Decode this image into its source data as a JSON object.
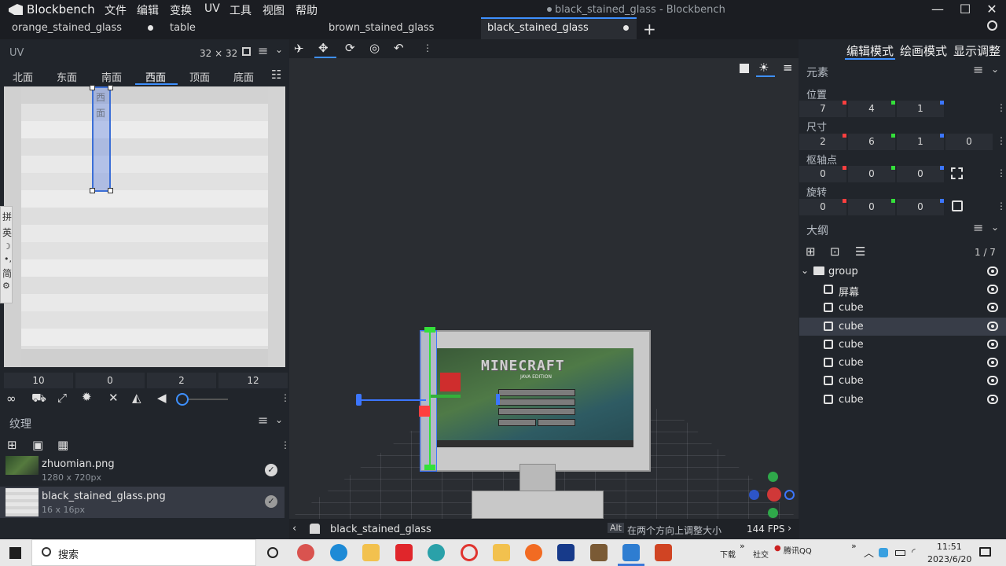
{
  "app": {
    "name": "Blockbench",
    "window_title": "black_stained_glass - Blockbench",
    "menu": [
      "文件",
      "编辑",
      "变换",
      "UV",
      "工具",
      "视图",
      "帮助"
    ]
  },
  "tabs": [
    {
      "label": "orange_stained_glass"
    },
    {
      "label": "table"
    },
    {
      "label": "brown_stained_glass"
    },
    {
      "label": "black_stained_glass",
      "active": true
    }
  ],
  "uv_panel": {
    "title": "UV",
    "size": "32 × 32",
    "faces": [
      "北面",
      "东面",
      "南面",
      "西面",
      "顶面",
      "底面"
    ],
    "selected_face": "西面",
    "face_overlay_label": "西面",
    "values": [
      "10",
      "0",
      "2",
      "12"
    ]
  },
  "texture_panel": {
    "title": "纹理",
    "items": [
      {
        "name": "zhuomian.png",
        "size": "1280 x 720px"
      },
      {
        "name": "black_stained_glass.png",
        "size": "16 x 16px",
        "selected": true
      }
    ]
  },
  "ime_bar": [
    "拼",
    "英",
    "简"
  ],
  "mode_tabs": [
    "编辑模式",
    "绘画模式",
    "显示调整"
  ],
  "element_panel": {
    "title": "元素",
    "position": {
      "label": "位置",
      "values": [
        "7",
        "4",
        "1"
      ]
    },
    "size": {
      "label": "尺寸",
      "values": [
        "2",
        "6",
        "1",
        "0"
      ]
    },
    "pivot": {
      "label": "枢轴点",
      "values": [
        "0",
        "0",
        "0"
      ]
    },
    "rotation": {
      "label": "旋转",
      "values": [
        "0",
        "0",
        "0"
      ]
    }
  },
  "outliner": {
    "title": "大纲",
    "count": "1 / 7",
    "group": "group",
    "items": [
      {
        "label": "屏幕"
      },
      {
        "label": "cube"
      },
      {
        "label": "cube",
        "selected": true
      },
      {
        "label": "cube"
      },
      {
        "label": "cube"
      },
      {
        "label": "cube"
      },
      {
        "label": "cube"
      }
    ]
  },
  "viewport": {
    "model_texture_text": "MINECRAFT",
    "model_texture_subtitle": "JAVA EDITION"
  },
  "status": {
    "model_name": "black_stained_glass",
    "key": "Alt",
    "hint": "在两个方向上调整大小",
    "fps": "144 FPS"
  },
  "taskbar": {
    "search": "搜索",
    "tray_download": "下载",
    "tray_social": "社交",
    "tray_qq": "腾讯QQ",
    "time": "11:51",
    "date": "2023/6/20"
  },
  "colors": {
    "accent": "#3e90ff",
    "x_axis": "#ff3f3f",
    "y_axis": "#34e03a",
    "z_axis": "#3c76ff"
  }
}
